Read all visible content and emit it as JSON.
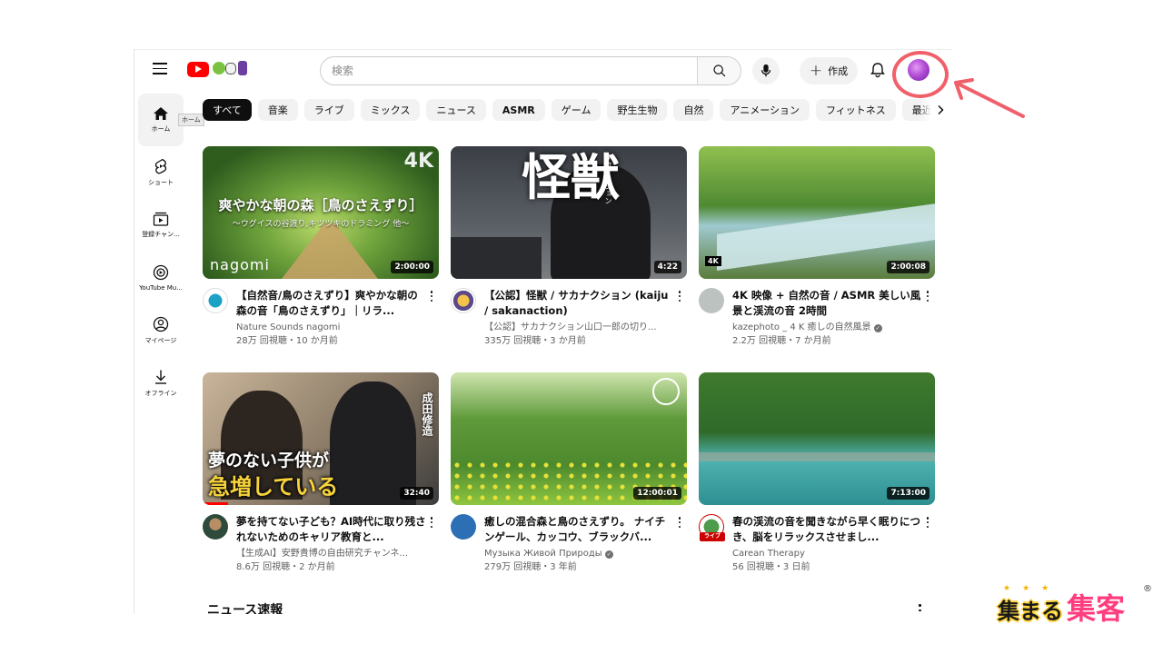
{
  "header": {
    "search_placeholder": "検索",
    "create_label": "作成"
  },
  "sidebar": {
    "items": [
      {
        "label": "ホーム"
      },
      {
        "label": "ショート"
      },
      {
        "label": "登録チャン..."
      },
      {
        "label": "YouTube Mu..."
      },
      {
        "label": "マイページ"
      },
      {
        "label": "オフライン"
      }
    ],
    "tooltip": "ホーム"
  },
  "chips": [
    "すべて",
    "音楽",
    "ライブ",
    "ミックス",
    "ニュース",
    "ASMR",
    "ゲーム",
    "野生生物",
    "自然",
    "アニメーション",
    "フィットネス",
    "最近アップ"
  ],
  "videos": [
    {
      "title": "【自然音/鳥のさえずり】爽やかな朝の森の音「鳥のさえずり」｜リラ...",
      "channel": "Nature Sounds nagomi",
      "stats": "28万 回視聴・10 か月前",
      "duration": "2:00:00",
      "thumb_big": "爽やかな朝の森［鳥のさえずり］",
      "thumb_small": "〜ウグイスの谷渡り,キツツキのドラミング 他〜",
      "thumb_corner": "4K",
      "thumb_brand": "nagomi"
    },
    {
      "title": "【公認】怪獣 / サカナクション (kaiju / sakanaction)",
      "channel": "【公認】サカナクション山口一郎の切り...",
      "stats": "335万 回視聴・3 か月前",
      "duration": "4:22",
      "thumb_big": "怪獣",
      "thumb_small": "サカナクション"
    },
    {
      "title": "4K 映像 + 自然の音 / ASMR 美しい風景と渓流の音 2時間",
      "channel": "kazephoto _ 4 K 癒しの自然風景",
      "stats": "2.2万 回視聴・7 か月前",
      "duration": "2:00:08",
      "thumb_corner": "4K"
    },
    {
      "title": "夢を持てない子ども？AI時代に取り残されないためのキャリア教育と...",
      "channel": "【生成AI】安野貴博の自由研究チャンネ...",
      "stats": "8.6万 回視聴・2 か月前",
      "duration": "32:40",
      "thumb_line1": "夢のない子供が",
      "thumb_line2": "急増している",
      "thumb_side": "成田修造"
    },
    {
      "title": "癒しの混合森と鳥のさえずり。 ナイチンゲール、カッコウ、ブラックバ...",
      "channel": "Музыка Живой Природы",
      "stats": "279万 回視聴・3 年前",
      "duration": "12:00:01"
    },
    {
      "title": "春の渓流の音を聞きながら早く眠りにつき、脳をリラックスさせまし...",
      "channel": "Carean Therapy",
      "stats": "56 回視聴・3 日前",
      "duration": "7:13:00",
      "live_label": "ライブ"
    }
  ],
  "section_title": "ニュース速報",
  "brand": {
    "part1": "集まる",
    "part2": "集客",
    "reg": "®"
  },
  "colors": {
    "accent_red": "#ff0000",
    "annotation": "#f0606a"
  }
}
